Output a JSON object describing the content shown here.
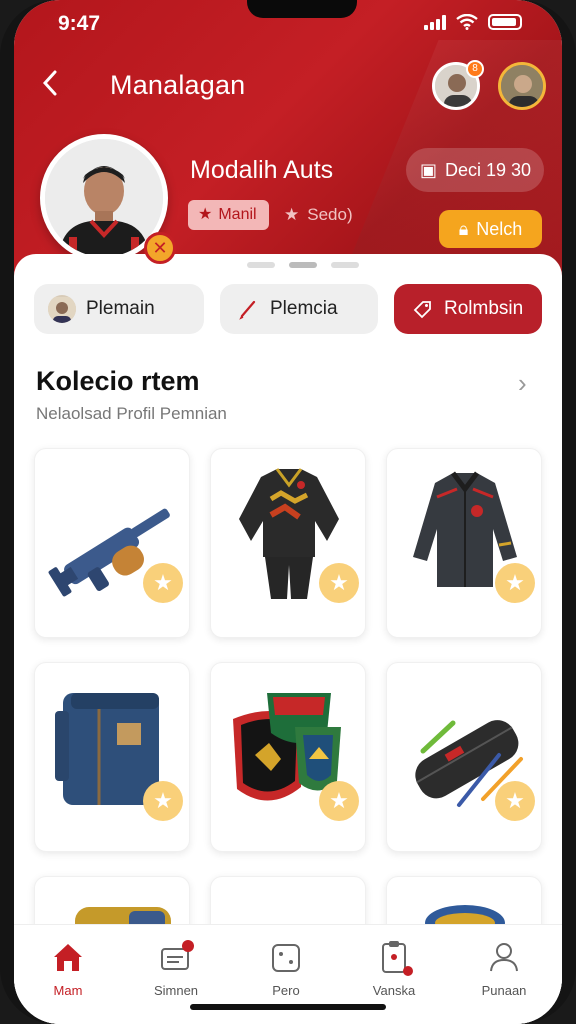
{
  "status": {
    "time": "9:47"
  },
  "header": {
    "title": "Manalagan",
    "notif_count": "8",
    "profile_name": "Modalih Auts",
    "chip_primary": "Manil",
    "chip_secondary": "Sedo)",
    "score": "Deci 19 30",
    "match_button": "Nelch"
  },
  "tabs": [
    {
      "label": "Plemain"
    },
    {
      "label": "Plemcia"
    },
    {
      "label": "Rolmbsin"
    }
  ],
  "section": {
    "title": "Kolecio rtem",
    "subtitle": "Nelaolsad Profil Pemnian"
  },
  "items": [
    {
      "name": "gun-item"
    },
    {
      "name": "tracksuit-item"
    },
    {
      "name": "jacket-item"
    },
    {
      "name": "backpack-item"
    },
    {
      "name": "shields-item"
    },
    {
      "name": "pencil-case-item"
    }
  ],
  "nav": [
    {
      "label": "Mam"
    },
    {
      "label": "Simnen"
    },
    {
      "label": "Pero"
    },
    {
      "label": "Vanska"
    },
    {
      "label": "Punaan"
    }
  ],
  "colors": {
    "primary": "#c41f25",
    "accent": "#f5a51e",
    "star": "#f9d07a"
  }
}
